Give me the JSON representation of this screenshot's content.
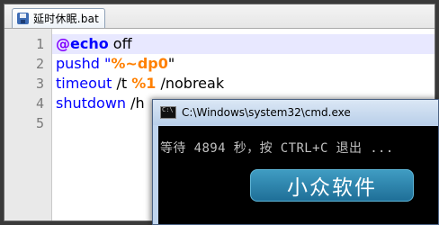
{
  "editor": {
    "tab_title": "延时休眠.bat",
    "line_numbers": [
      "1",
      "2",
      "3",
      "4",
      "5"
    ],
    "lines": [
      {
        "t1": "@",
        "t2": "echo",
        "t3": " off"
      },
      {
        "t1": "pushd \"",
        "t2": "%~dp0",
        "t3": "\""
      },
      {
        "t1": "timeout",
        "t2": " /t ",
        "t3": "%1",
        "t4": " /nobreak"
      },
      {
        "t1": "shutdown",
        "t2": " /h"
      }
    ]
  },
  "cmd": {
    "title": "C:\\Windows\\system32\\cmd.exe",
    "output": "等待 4894 秒，按 CTRL+C 退出 ...",
    "watermark": "小众软件"
  },
  "colors": {
    "keyword_purple": "#8000ff",
    "keyword_blue": "#0000ff",
    "variable_orange": "#ff8000",
    "current_line": "#e8e8ff"
  }
}
